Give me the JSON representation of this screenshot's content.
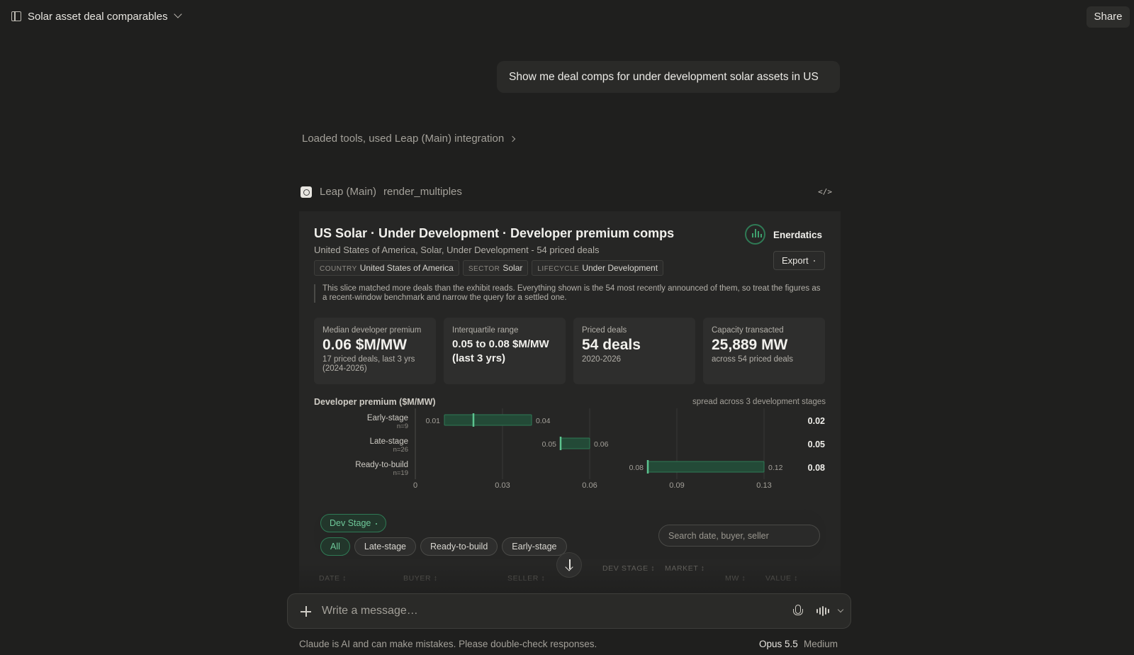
{
  "header": {
    "title": "Solar asset deal comparables",
    "share_label": "Share"
  },
  "user_message": "Show me deal comps for under development solar assets in US",
  "tools_summary": "Loaded tools, used Leap (Main) integration",
  "tool": {
    "integration": "Leap (Main)",
    "function": "render_multiples"
  },
  "widget": {
    "title": "US Solar · Under Development · Developer premium comps",
    "subtitle": "United States of America, Solar, Under Development - 54 priced deals",
    "brand": "Enerdatics",
    "export_label": "Export",
    "chips": [
      {
        "key": "COUNTRY",
        "value": "United States of America"
      },
      {
        "key": "SECTOR",
        "value": "Solar"
      },
      {
        "key": "LIFECYCLE",
        "value": "Under Development"
      }
    ],
    "note": "This slice matched more deals than the exhibit reads. Everything shown is the 54 most recently announced of them, so treat the figures as a recent-window benchmark and narrow the query for a settled one.",
    "kpis": [
      {
        "label": "Median developer premium",
        "value": "0.06 $M/MW",
        "detail": "17 priced deals, last 3 yrs (2024-2026)"
      },
      {
        "label": "Interquartile range",
        "value": "0.05 to 0.08 $M/MW (last 3 yrs)",
        "detail": ""
      },
      {
        "label": "Priced deals",
        "value": "54 deals",
        "detail": "2020-2026"
      },
      {
        "label": "Capacity transacted",
        "value": "25,889 MW",
        "detail": "across 54 priced deals"
      }
    ],
    "chart_title": "Developer premium ($M/MW)",
    "chart_note": "spread across 3 development stages",
    "filter": {
      "group_label": "Dev Stage",
      "options": [
        "All",
        "Late-stage",
        "Ready-to-build",
        "Early-stage"
      ],
      "selected": "All",
      "search_placeholder": "Search date, buyer, seller"
    },
    "table_columns": [
      "DATE ↕",
      "BUYER ↕",
      "SELLER ↕",
      "DEV STAGE ↕",
      "MARKET ↕",
      "MW ↕",
      "VALUE ↕"
    ]
  },
  "chart_data": {
    "type": "bar",
    "orientation": "horizontal-range",
    "categories": [
      "Early-stage",
      "Late-stage",
      "Ready-to-build"
    ],
    "counts": [
      "n=9",
      "n=26",
      "n=19"
    ],
    "low": [
      0.01,
      0.05,
      0.08
    ],
    "high": [
      0.04,
      0.06,
      0.12
    ],
    "low_labels": [
      "0.01",
      "0.05",
      "0.08"
    ],
    "high_labels": [
      "0.04",
      "0.06",
      "0.12"
    ],
    "median": [
      0.02,
      0.05,
      0.08
    ],
    "median_labels": [
      "0.02",
      "0.05",
      "0.08"
    ],
    "x_ticks": [
      0,
      0.03,
      0.06,
      0.09,
      0.12
    ],
    "x_tick_labels": [
      "0",
      "0.03",
      "0.06",
      "0.09",
      "0.13"
    ],
    "xlim": [
      0,
      0.12
    ],
    "grid": true,
    "bar_color": "#2f7a55"
  },
  "composer": {
    "placeholder": "Write a message…"
  },
  "footer": {
    "disclaimer": "Claude is AI and can make mistakes. Please double-check responses.",
    "model": "Opus 5.5",
    "effort": "Medium"
  }
}
